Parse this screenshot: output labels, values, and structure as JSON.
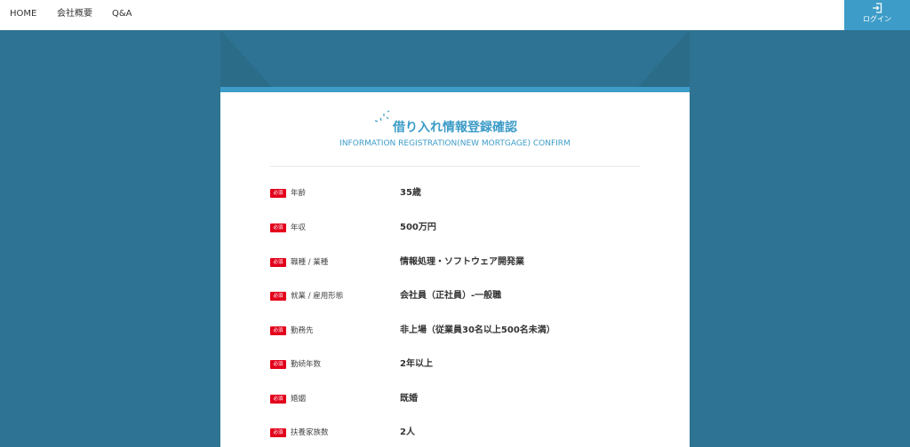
{
  "nav": {
    "links": [
      "HOME",
      "会社概要",
      "Q&A"
    ],
    "login_label": "ログイン"
  },
  "form": {
    "title": "借り入れ情報登録確認",
    "subtitle": "INFORMATION REGISTRATION(NEW MORTGAGE) CONFIRM",
    "required_label": "必須",
    "rows": [
      {
        "label": "年齢",
        "value": "35歳"
      },
      {
        "label": "年収",
        "value": "500万円"
      },
      {
        "label": "職種 / 業種",
        "value": "情報処理・ソフトウェア開発業"
      },
      {
        "label": "就業 / 雇用形態",
        "value": "会社員（正社員）-一般職"
      },
      {
        "label": "勤務先",
        "value": "非上場（従業員30名以上500名未満）"
      },
      {
        "label": "勤続年数",
        "value": "2年以上"
      },
      {
        "label": "婚姻",
        "value": "既婚"
      },
      {
        "label": "扶養家族数",
        "value": "2人"
      }
    ]
  },
  "colors": {
    "background": "#2e7393",
    "accent": "#3d9cc8",
    "required_badge": "#e3001b"
  }
}
